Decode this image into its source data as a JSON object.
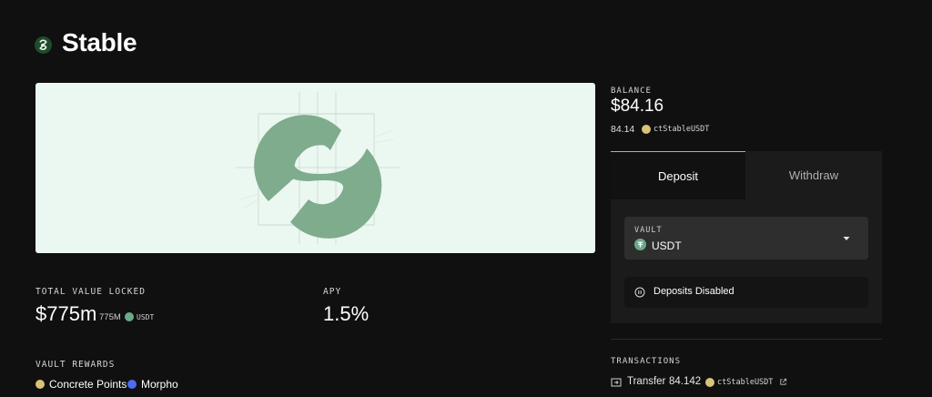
{
  "header": {
    "title": "Stable",
    "logo_icon": "stable-s-icon"
  },
  "stats": {
    "tvl_label": "TOTAL VALUE LOCKED",
    "tvl_value": "$775m",
    "tvl_amount": "775M",
    "tvl_token": "USDT",
    "apy_label": "APY",
    "apy_value": "1.5%"
  },
  "rewards": {
    "label": "VAULT REWARDS",
    "items": [
      {
        "name": "Concrete Points",
        "icon": "concrete-points-icon"
      },
      {
        "name": "Morpho",
        "icon": "morpho-icon"
      }
    ]
  },
  "balance": {
    "label": "BALANCE",
    "value": "$84.16",
    "amount": "84.14",
    "token": "ctStableUSDT"
  },
  "tabs": [
    {
      "label": "Deposit",
      "active": true
    },
    {
      "label": "Withdraw",
      "active": false
    }
  ],
  "vault": {
    "label": "VAULT",
    "selected": "USDT"
  },
  "deposit_status": "Deposits Disabled",
  "transactions": {
    "label": "TRANSACTIONS",
    "items": [
      {
        "type": "Transfer",
        "amount": "84.142",
        "token": "ctStableUSDT"
      }
    ]
  },
  "colors": {
    "background": "#101010",
    "hero_bg": "#ebf7f1",
    "brand_green": "#7fac8c",
    "active_tab_accent": "#c9b458",
    "panel_bg": "#1b1b1b"
  }
}
